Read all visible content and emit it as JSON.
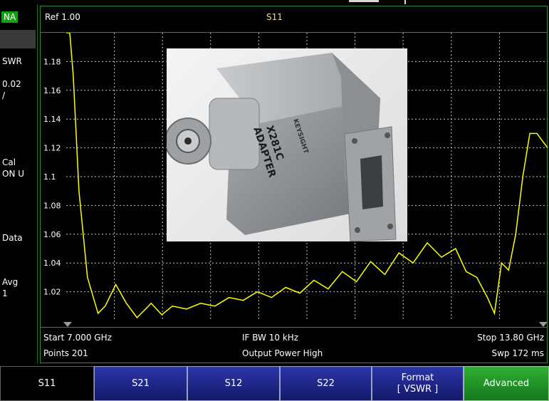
{
  "mode": "NA",
  "left_panel": {
    "format": "SWR",
    "scale": "0.02\n/",
    "cal": "Cal\nON U",
    "data": "Data",
    "avg": "Avg\n1"
  },
  "header": {
    "ref": "Ref 1.00",
    "measurement": "S11"
  },
  "chart_data": {
    "type": "line",
    "y_tick_labels": [
      "1.18",
      "1.16",
      "1.14",
      "1.12",
      "1.1",
      "1.08",
      "1.06",
      "1.04",
      "1.02"
    ],
    "ylim": [
      1.0,
      1.2
    ],
    "xlim": [
      7.0,
      13.8
    ],
    "x_unit": "GHz",
    "grid": true,
    "series": [
      {
        "color": "#ffff00",
        "x": [
          7.0,
          7.05,
          7.1,
          7.18,
          7.3,
          7.45,
          7.55,
          7.7,
          7.85,
          8.0,
          8.2,
          8.35,
          8.5,
          8.7,
          8.9,
          9.1,
          9.3,
          9.5,
          9.7,
          9.9,
          10.1,
          10.3,
          10.5,
          10.7,
          10.9,
          11.1,
          11.3,
          11.5,
          11.7,
          11.9,
          12.1,
          12.3,
          12.5,
          12.65,
          12.8,
          12.95,
          13.05,
          13.15,
          13.25,
          13.35,
          13.45,
          13.55,
          13.65,
          13.8
        ],
        "y": [
          1.205,
          1.205,
          1.17,
          1.09,
          1.03,
          1.005,
          1.01,
          1.025,
          1.012,
          1.002,
          1.012,
          1.004,
          1.01,
          1.008,
          1.012,
          1.01,
          1.016,
          1.014,
          1.02,
          1.016,
          1.023,
          1.019,
          1.028,
          1.022,
          1.034,
          1.027,
          1.041,
          1.032,
          1.047,
          1.04,
          1.054,
          1.044,
          1.05,
          1.034,
          1.03,
          1.016,
          1.005,
          1.04,
          1.035,
          1.06,
          1.1,
          1.13,
          1.13,
          1.12
        ]
      }
    ]
  },
  "footer": {
    "start": "Start 7.000 GHz",
    "points": "Points 201",
    "ifbw": "IF BW 10 kHz",
    "power": "Output Power High",
    "stop": "Stop 13.80 GHz",
    "sweep": "Swp 172 ms"
  },
  "photo": {
    "label_line1": "X281C",
    "label_line2": "ADAPTER",
    "brand": "KEYSIGHT"
  },
  "softkeys": [
    {
      "label": "S11",
      "sub": ""
    },
    {
      "label": "S21",
      "sub": ""
    },
    {
      "label": "S12",
      "sub": ""
    },
    {
      "label": "S22",
      "sub": ""
    },
    {
      "label": "Format",
      "sub": "[ VSWR ]"
    },
    {
      "label": "Advanced",
      "sub": ""
    }
  ]
}
